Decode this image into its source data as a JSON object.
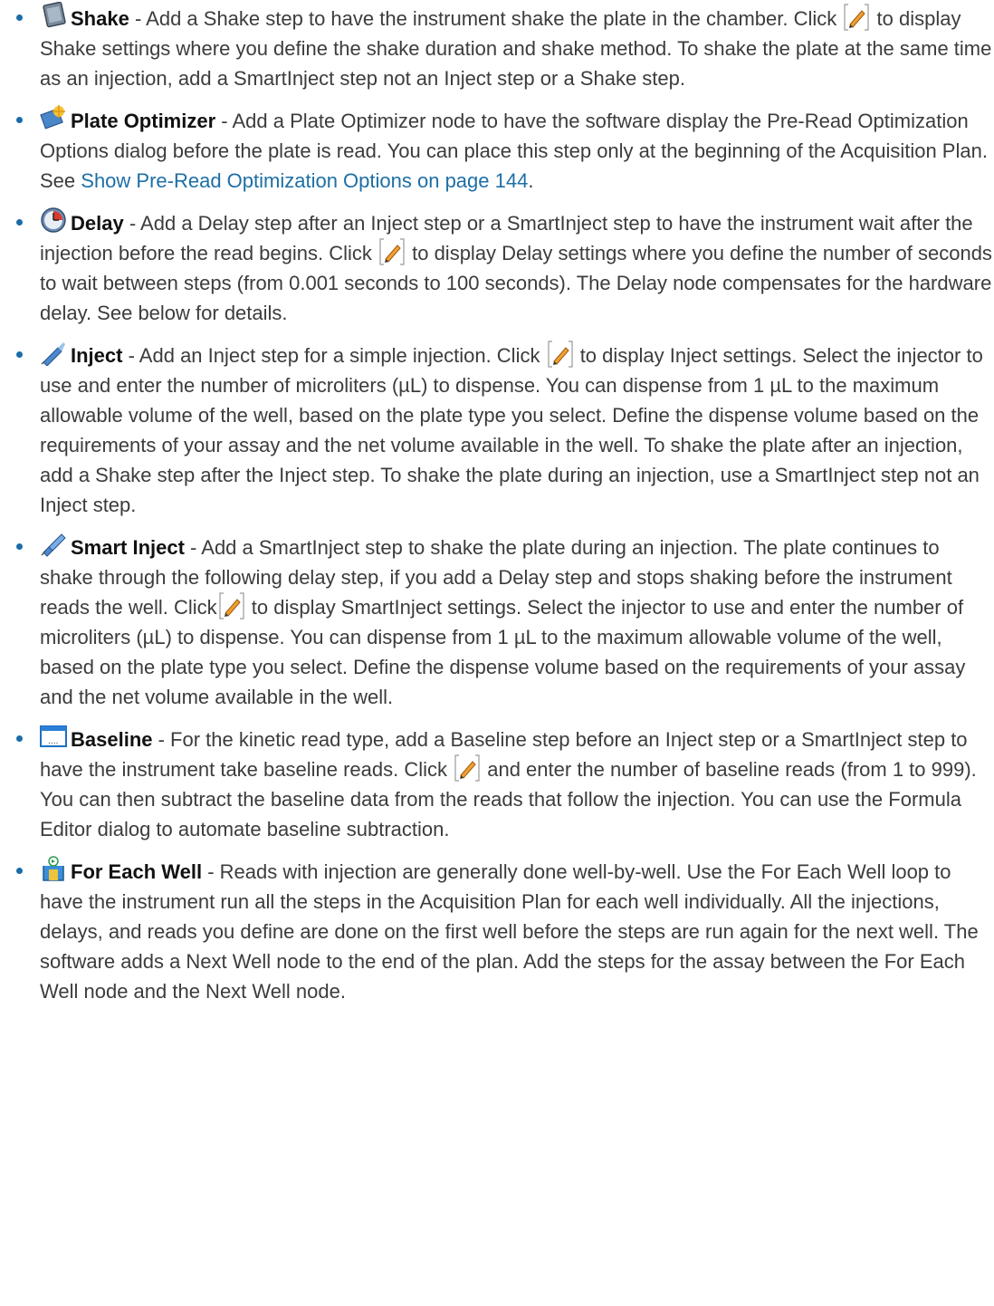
{
  "steps": [
    {
      "icon": "shake-icon",
      "name": "Shake",
      "t0": " - Add a Shake step to have the instrument shake the plate in the chamber. Click ",
      "t1": " to display Shake settings where you define the shake duration and shake method. To shake the plate at the same time as an injection, add a SmartInject step not an Inject step or a Shake step."
    },
    {
      "icon": "plate-optimizer-icon",
      "name": "Plate Optimizer",
      "t0": " - Add a Plate Optimizer node to have the software display the Pre-Read Optimization Options dialog before the plate is read. You can place this step only at the beginning of the Acquisition Plan. See ",
      "link": "Show Pre-Read Optimization Options on page 144",
      "t1": "."
    },
    {
      "icon": "delay-icon",
      "name": "Delay",
      "t0": " - Add a Delay step after an Inject step or a SmartInject step to have the instrument wait after the injection before the read begins. Click ",
      "t1": " to display Delay settings where you define the number of seconds to wait between steps (from 0.001 seconds to 100 seconds). The Delay node compensates for the hardware delay. See below for details."
    },
    {
      "icon": "inject-icon",
      "name": "Inject",
      "t0": " - Add an Inject step for a simple injection. Click ",
      "t1": " to display Inject settings. Select the injector to use and enter the number of microliters (µL) to dispense. You can dispense from 1 µL to the maximum allowable volume of the well, based on the plate type you select. Define the dispense volume based on the requirements of your assay and the net volume available in the well. To shake the plate after an injection, add a Shake step after the Inject step. To shake the plate during an injection, use a SmartInject step not an Inject step."
    },
    {
      "icon": "smart-inject-icon",
      "name": "Smart Inject",
      "t0": " - Add a SmartInject step to shake the plate during an injection. The plate continues to shake through the following delay step, if you add a Delay step and stops shaking before the instrument reads the well. Click",
      "t1": " to display SmartInject settings. Select the injector to use and enter the number of microliters (µL) to dispense. You can dispense from 1 µL to the maximum allowable volume of the well, based on the plate type you select. Define the dispense volume based on the requirements of your assay and the net volume available in the well."
    },
    {
      "icon": "baseline-icon",
      "name": "Baseline",
      "t0": " - For the kinetic read type, add a Baseline step before an Inject step or a SmartInject step to have the instrument take baseline reads. Click ",
      "t1": " and enter the number of baseline reads (from 1 to 999). You can then subtract the baseline data from the reads that follow the injection. You can use the Formula Editor dialog to automate baseline subtraction."
    },
    {
      "icon": "for-each-well-icon",
      "name": "For Each Well",
      "t0": " - Reads with injection are generally done well-by-well. Use the For Each Well loop to have the instrument run all the steps in the Acquisition Plan for each well individually. All the injections, delays, and reads you define are done on the first well before the steps are run again for the next well. The software adds a Next Well node to the end of the plan. Add the steps for the assay between the For Each Well node and the Next Well node."
    }
  ],
  "edit_button_icon": "pencil-edit-icon"
}
